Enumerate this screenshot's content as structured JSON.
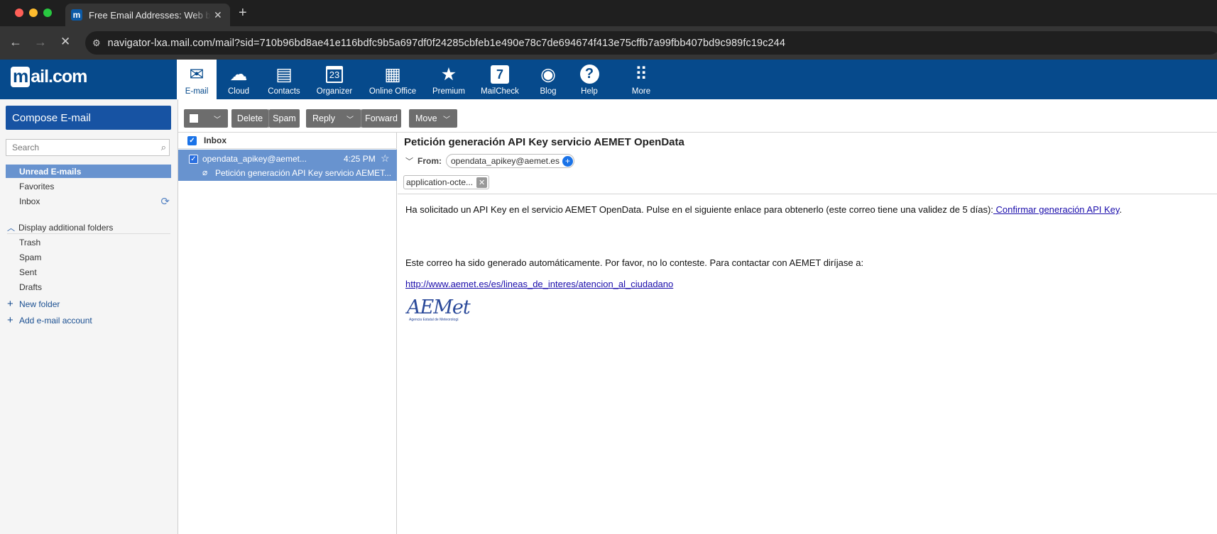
{
  "browser": {
    "tab_title": "Free Email Addresses: Web b",
    "tab_favicon": "m",
    "url": "navigator-lxa.mail.com/mail?sid=710b96bd8ae41e116bdfc9b5a697df0f24285cbfeb1e490e78c7de694674f413e75cffb7a99fbb407bd9c989fc19c244"
  },
  "header": {
    "logo_mark": "m",
    "logo_text": "ail.com",
    "nav": [
      {
        "label": "E-mail",
        "icon": "envelope-icon",
        "glyph": "✉"
      },
      {
        "label": "Cloud",
        "icon": "cloud-icon",
        "glyph": "☁"
      },
      {
        "label": "Contacts",
        "icon": "contacts-icon",
        "glyph": "▤"
      },
      {
        "label": "Organizer",
        "icon": "calendar-icon",
        "glyph": "23"
      },
      {
        "label": "Online Office",
        "icon": "office-icon",
        "glyph": "▦"
      },
      {
        "label": "Premium",
        "icon": "star-icon",
        "glyph": "★"
      },
      {
        "label": "MailCheck",
        "icon": "mailcheck-icon",
        "glyph": "7"
      },
      {
        "label": "Blog",
        "icon": "lightbulb-icon",
        "glyph": "◉"
      },
      {
        "label": "Help",
        "icon": "help-icon",
        "glyph": "?"
      },
      {
        "label": "More",
        "icon": "grid-icon",
        "glyph": "⠿"
      }
    ]
  },
  "sidebar": {
    "compose_label": "Compose E-mail",
    "search_placeholder": "Search",
    "folders": [
      "Unread E-mails",
      "Favorites",
      "Inbox"
    ],
    "additional_label": "Display additional folders",
    "extra_folders": [
      "Trash",
      "Spam",
      "Sent",
      "Drafts"
    ],
    "new_folder": "New folder",
    "add_account": "Add e-mail account"
  },
  "toolbar": {
    "delete": "Delete",
    "spam": "Spam",
    "reply": "Reply",
    "forward": "Forward",
    "move": "Move"
  },
  "list": {
    "header": "Inbox",
    "message": {
      "from": "opendata_apikey@aemet...",
      "time": "4:25 PM",
      "subject": "Petición generación API Key servicio AEMET..."
    }
  },
  "reader": {
    "subject": "Petición generación API Key servicio AEMET OpenData",
    "from_label": "From:",
    "sender": "opendata_apikey@aemet.es",
    "attachment": "application-octe...",
    "para1": "Ha solicitado un API Key en el servicio AEMET OpenData. Pulse en el siguiente enlace para obtenerlo (este correo tiene una validez de 5 días):",
    "para1_link": " Confirmar generación API Key",
    "para1_end": ".",
    "para2": "Este correo ha sido generado automáticamente. Por favor, no lo conteste. Para contactar con AEMET diríjase a:",
    "link2": "http://www.aemet.es/es/lineas_de_interes/atencion_al_ciudadano",
    "logo_text": "AEMet",
    "logo_subtext": "Agencia Estatal de Meteorología"
  }
}
